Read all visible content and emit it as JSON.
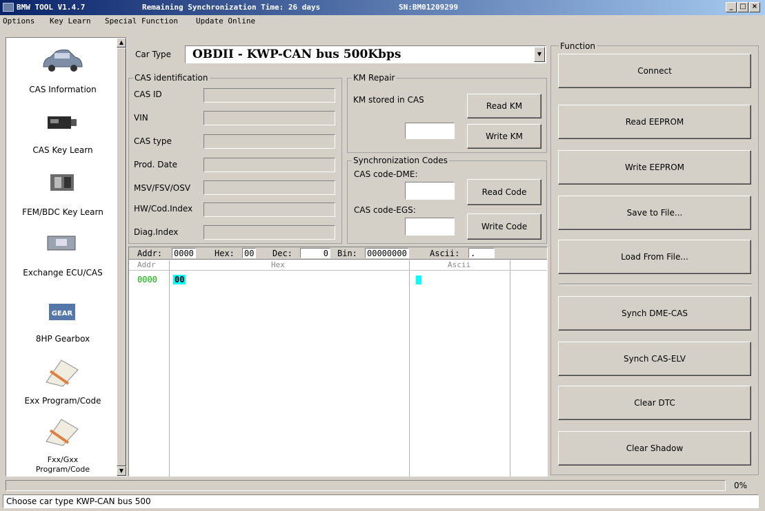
{
  "window": {
    "title": "BMW TOOL V1.4.7",
    "sync_text": "Remaining Synchronization Time: 26 days",
    "serial": "SN:BM01209299"
  },
  "menu": [
    "Options",
    "Key Learn",
    "Special Function",
    "Update Online"
  ],
  "sidebar": {
    "items": [
      {
        "label": "CAS Information",
        "icon": "car-icon"
      },
      {
        "label": "CAS Key Learn",
        "icon": "cas-module-icon"
      },
      {
        "label": "FEM/BDC Key Learn",
        "icon": "fem-module-icon"
      },
      {
        "label": "Exchange ECU/CAS",
        "icon": "ecu-chip-icon"
      },
      {
        "label": "8HP Gearbox",
        "icon": "gearbox-icon"
      },
      {
        "label": "Exx Program/Code",
        "icon": "document-pen-icon"
      },
      {
        "label": "Fxx/Gxx\nProgram/Code",
        "icon": "document-pen-icon"
      }
    ]
  },
  "car_type": {
    "label": "Car Type",
    "value": "OBDII - KWP-CAN bus 500Kbps"
  },
  "cas_identification": {
    "legend": "CAS identification",
    "fields": [
      {
        "label": "CAS ID",
        "value": ""
      },
      {
        "label": "VIN",
        "value": ""
      },
      {
        "label": "CAS type",
        "value": ""
      },
      {
        "label": "Prod. Date",
        "value": ""
      },
      {
        "label": "MSV/FSV/OSV",
        "value": ""
      },
      {
        "label": "HW/Cod.Index",
        "value": ""
      },
      {
        "label": "Diag.Index",
        "value": ""
      }
    ]
  },
  "km_repair": {
    "legend": "KM Repair",
    "stored_label": "KM stored in CAS",
    "read_label": "Read KM",
    "write_label": "Write KM"
  },
  "sync_codes": {
    "legend": "Synchronization Codes",
    "dme_label": "CAS code-DME:",
    "egs_label": "CAS code-EGS:",
    "read_label": "Read Code",
    "write_label": "Write Code"
  },
  "hex": {
    "addr_label": "Addr:",
    "addr_value": "0000",
    "hex_label": "Hex:",
    "hex_value": "00",
    "dec_label": "Dec:",
    "dec_value": "0",
    "bin_label": "Bin:",
    "bin_value": "00000000",
    "ascii_label": "Ascii:",
    "ascii_value": ".",
    "col_addr": "Addr",
    "col_hex": "Hex",
    "col_ascii": "Ascii",
    "row_addr": "0000",
    "row_byte": "00",
    "colors": {
      "addr_row": "#00c000",
      "highlight": "#00ffff"
    }
  },
  "function": {
    "legend": "Function",
    "buttons": [
      "Connect",
      "Read EEPROM",
      "Write EEPROM",
      "Save to File...",
      "Load From File...",
      "Synch DME-CAS",
      "Synch CAS-ELV",
      "Clear DTC",
      "Clear Shadow"
    ]
  },
  "progress": {
    "value": 0,
    "label": "0%"
  },
  "status": "Choose car type KWP-CAN bus 500",
  "colors": {
    "title_start": "#0a246a",
    "title_end": "#a6caf0",
    "face": "#d4d0c8"
  }
}
